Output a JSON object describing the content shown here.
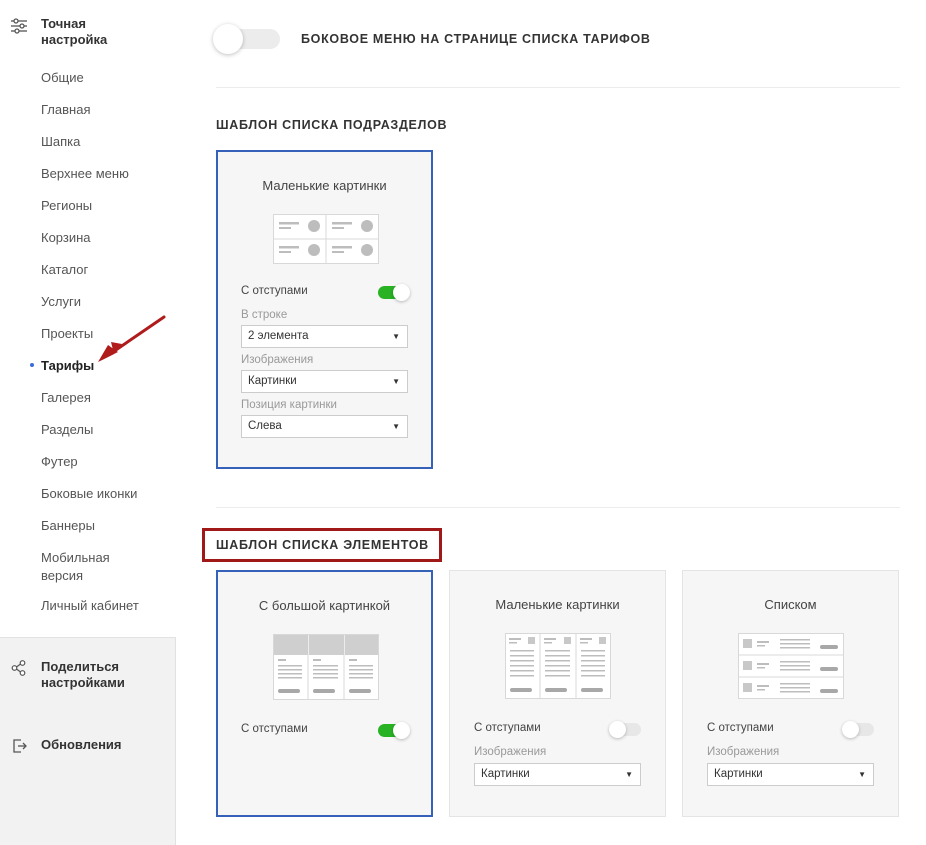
{
  "sidebar": {
    "title": "Точная настройка",
    "items": [
      {
        "label": "Общие"
      },
      {
        "label": "Главная"
      },
      {
        "label": "Шапка"
      },
      {
        "label": "Верхнее меню"
      },
      {
        "label": "Регионы"
      },
      {
        "label": "Корзина"
      },
      {
        "label": "Каталог"
      },
      {
        "label": "Услуги"
      },
      {
        "label": "Проекты"
      },
      {
        "label": "Тарифы",
        "active": true
      },
      {
        "label": "Галерея"
      },
      {
        "label": "Разделы"
      },
      {
        "label": "Футер"
      },
      {
        "label": "Боковые иконки"
      },
      {
        "label": "Баннеры"
      },
      {
        "label": "Мобильная версия"
      },
      {
        "label": "Личный кабинет"
      }
    ],
    "share_label": "Поделиться настройками",
    "updates_label": "Обновления"
  },
  "main": {
    "side_menu_toggle_label": "БОКОВОЕ МЕНЮ НА СТРАНИЦЕ СПИСКА ТАРИФОВ",
    "side_menu_toggle_on": false,
    "subsections": {
      "heading": "ШАБЛОН СПИСКА ПОДРАЗДЕЛОВ",
      "card": {
        "title": "Маленькие картинки",
        "padding_label": "С отступами",
        "padding_on": true,
        "per_row_label": "В строке",
        "per_row_value": "2 элемента",
        "images_label": "Изображения",
        "images_value": "Картинки",
        "image_pos_label": "Позиция картинки",
        "image_pos_value": "Слева"
      }
    },
    "elements": {
      "heading": "ШАБЛОН СПИСКА ЭЛЕМЕНТОВ",
      "cards": [
        {
          "title": "С большой картинкой",
          "padding_label": "С отступами",
          "padding_on": true,
          "selected": true
        },
        {
          "title": "Маленькие картинки",
          "padding_label": "С отступами",
          "padding_on": false,
          "images_label": "Изображения",
          "images_value": "Картинки"
        },
        {
          "title": "Списком",
          "padding_label": "С отступами",
          "padding_on": false,
          "images_label": "Изображения",
          "images_value": "Картинки"
        }
      ]
    }
  },
  "colors": {
    "accent": "#3562b8",
    "toggle_on": "#28b224",
    "highlight": "#a01818",
    "arrow": "#b01c1c"
  }
}
